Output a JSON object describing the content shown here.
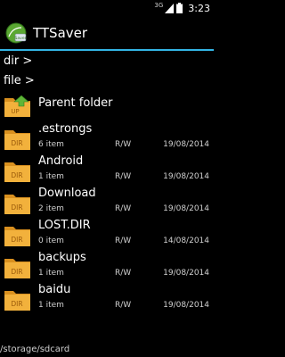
{
  "status_bar": {
    "network": "3G",
    "time": "3:23"
  },
  "app": {
    "title": "TTSaver",
    "icon_text": "Saver"
  },
  "path_rows": {
    "dir_label": "dir >",
    "file_label": "file >"
  },
  "parent": {
    "label": "Parent folder",
    "icon_text": "UP"
  },
  "folder_icon_text": "DIR",
  "files": [
    {
      "name": ".estrongs",
      "count": "6 item",
      "perm": "R/W",
      "date": "19/08/2014"
    },
    {
      "name": "Android",
      "count": "1 item",
      "perm": "R/W",
      "date": "19/08/2014"
    },
    {
      "name": "Download",
      "count": "2 item",
      "perm": "R/W",
      "date": "19/08/2014"
    },
    {
      "name": "LOST.DIR",
      "count": "0 item",
      "perm": "R/W",
      "date": "14/08/2014"
    },
    {
      "name": "backups",
      "count": "1 item",
      "perm": "R/W",
      "date": "19/08/2014"
    },
    {
      "name": "baidu",
      "count": "1 item",
      "perm": "R/W",
      "date": "19/08/2014"
    }
  ],
  "footer": {
    "current_path": "/storage/sdcard"
  },
  "colors": {
    "accent": "#33b5e5",
    "folder": "#f2b13c",
    "folder_dark": "#d9901f",
    "app_icon": "#5aa832"
  }
}
